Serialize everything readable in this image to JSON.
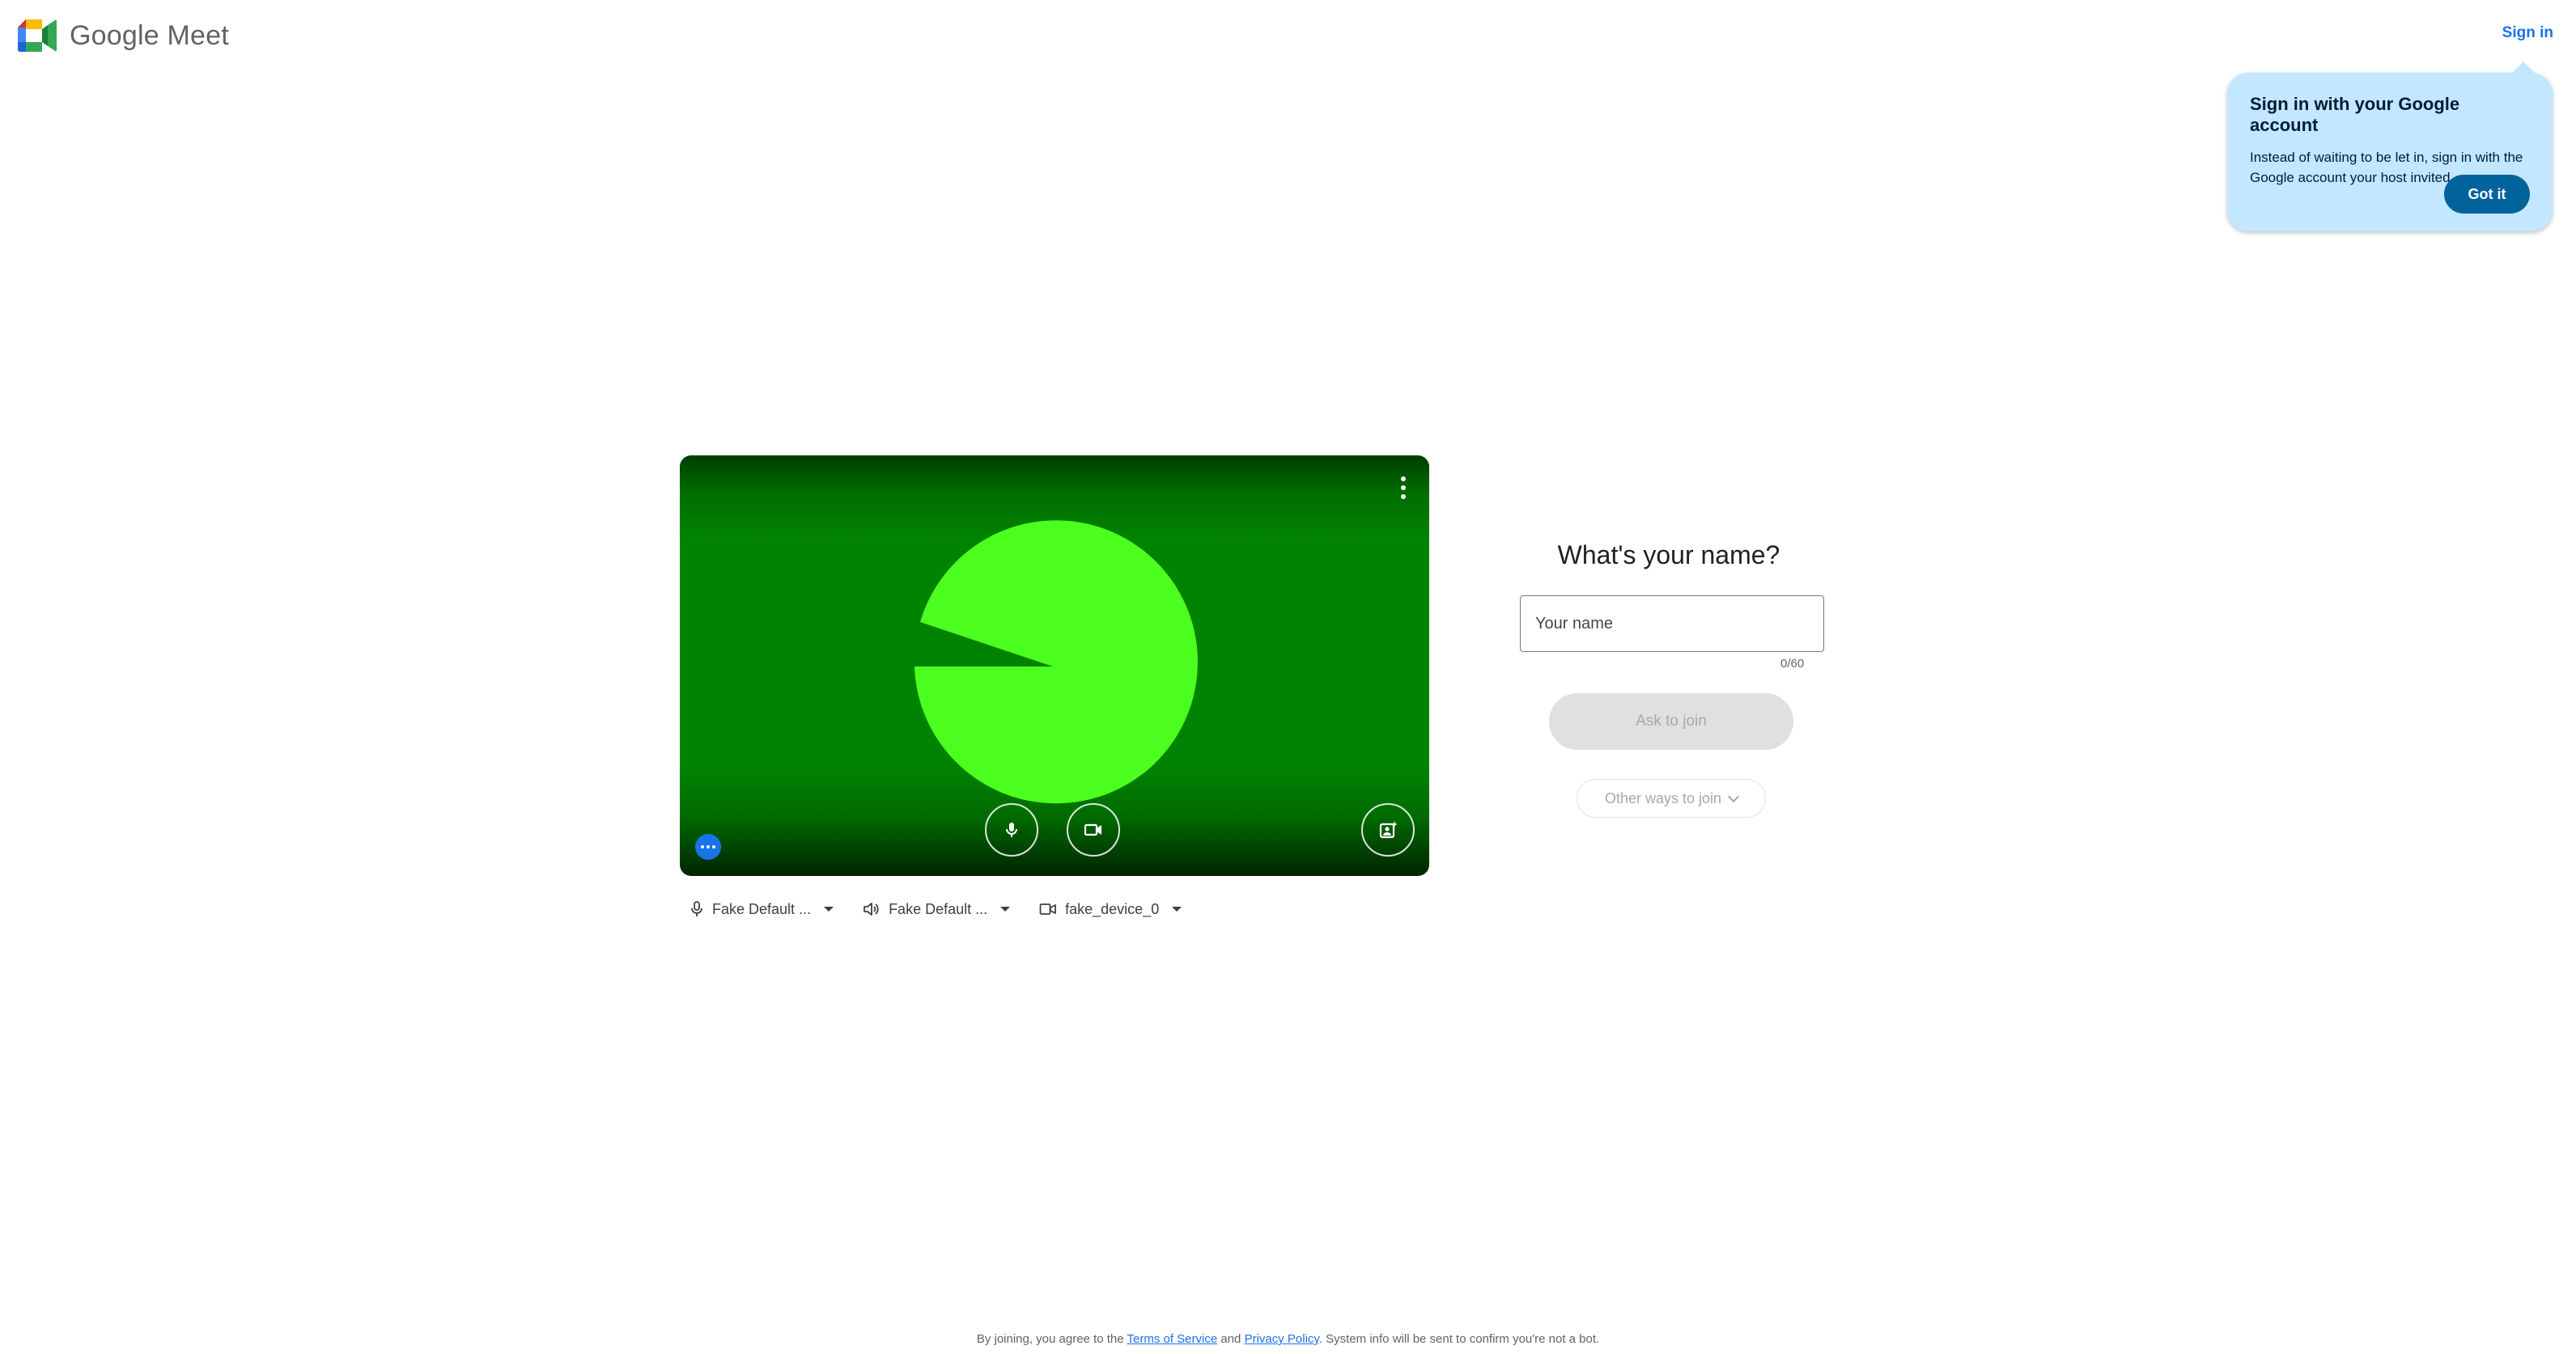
{
  "app": {
    "brand_google": "Google",
    "brand_meet": "Meet",
    "sign_in": "Sign in"
  },
  "callout": {
    "title": "Sign in with your Google account",
    "body": "Instead of waiting to be let in, sign in with the Google account your host invited",
    "got_it": "Got it"
  },
  "devices": {
    "microphone": "Fake Default ...",
    "speaker": "Fake Default ...",
    "camera": "fake_device_0"
  },
  "join": {
    "title": "What's your name?",
    "name_placeholder": "Your name",
    "name_value": "",
    "char_count": "0/60",
    "ask_to_join": "Ask to join",
    "other_ways": "Other ways to join"
  },
  "footer": {
    "prefix": "By joining, you agree to the ",
    "terms": "Terms of Service",
    "and": " and ",
    "privacy": "Privacy Policy",
    "suffix": ". System info will be sent to confirm you're not a bot."
  },
  "colors": {
    "accent": "#1a73e8",
    "callout_bg": "#c2e7ff",
    "video_green": "#008300",
    "pac_green": "#4cff1f"
  },
  "icons": [
    "google-meet-logo",
    "more-vert-icon",
    "microphone-icon",
    "camera-icon",
    "visual-effects-icon",
    "more-horiz-icon",
    "speaker-icon",
    "chevron-down-icon"
  ]
}
